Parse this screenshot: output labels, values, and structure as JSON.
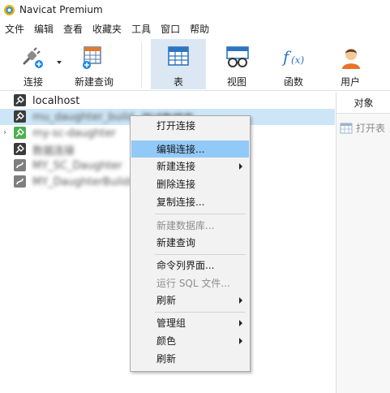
{
  "window": {
    "title": "Navicat Premium"
  },
  "menubar": [
    "文件",
    "编辑",
    "查看",
    "收藏夹",
    "工具",
    "窗口",
    "帮助"
  ],
  "toolbar": {
    "connect": "连接",
    "new_query": "新建查询",
    "table": "表",
    "view": "视图",
    "function": "函数",
    "user": "用户"
  },
  "tree": {
    "items": [
      {
        "name": "localhost",
        "extra": ""
      },
      {
        "name": "mu_daughter_build",
        "extra": "测试数据库"
      },
      {
        "name": "my-sc-daughter",
        "extra": ""
      },
      {
        "name": "数据连接",
        "extra": ""
      },
      {
        "name": "MY_SC_Daughter",
        "extra": ""
      },
      {
        "name": "MY_DaughterBuilds",
        "extra": ""
      }
    ]
  },
  "right_panel": {
    "tab": "对象",
    "open_table": "打开表"
  },
  "context_menu": {
    "items": [
      {
        "label": "打开连接",
        "disabled": false,
        "submenu": false
      },
      {
        "label": "编辑连接...",
        "disabled": false,
        "submenu": false,
        "highlighted": true
      },
      {
        "label": "新建连接",
        "disabled": false,
        "submenu": true
      },
      {
        "label": "删除连接",
        "disabled": false,
        "submenu": false
      },
      {
        "label": "复制连接...",
        "disabled": false,
        "submenu": false
      },
      {
        "label": "新建数据库...",
        "disabled": true,
        "submenu": false
      },
      {
        "label": "新建查询",
        "disabled": false,
        "submenu": false
      },
      {
        "label": "命令列界面...",
        "disabled": false,
        "submenu": false
      },
      {
        "label": "运行 SQL 文件...",
        "disabled": true,
        "submenu": false
      },
      {
        "label": "刷新",
        "disabled": false,
        "submenu": true
      },
      {
        "label": "管理组",
        "disabled": false,
        "submenu": true
      },
      {
        "label": "颜色",
        "disabled": false,
        "submenu": true
      },
      {
        "label": "刷新",
        "disabled": false,
        "submenu": false
      }
    ]
  },
  "colors": {
    "selection": "#cde6f7",
    "menu_highlight": "#91c9f7",
    "toolbar_active": "#dbe8f4"
  }
}
